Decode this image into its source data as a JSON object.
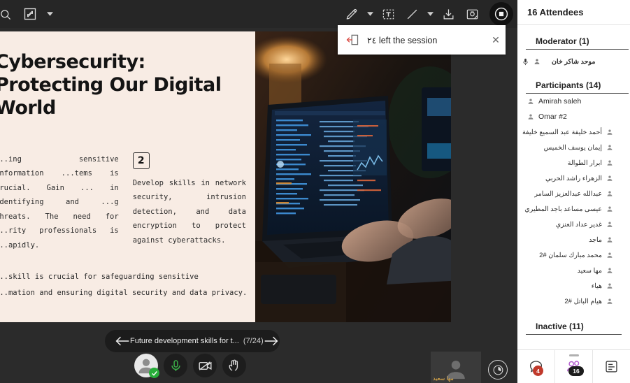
{
  "toolbar": {
    "search_icon": "search-icon",
    "fit_icon": "fit-screen-icon",
    "pen_icon": "pencil-icon",
    "text_icon": "text-box-icon",
    "line_icon": "line-icon",
    "download_icon": "download-icon",
    "snapshot_icon": "snapshot-icon",
    "record_icon": "stop-record-icon"
  },
  "toast": {
    "icon": "leave-session-icon",
    "message": "٢٤ left the session",
    "close_label": "✕"
  },
  "slide": {
    "title": "Cybersecurity: Protecting Our Digital World",
    "col1_text": "...ing sensitive information ...tems is crucial. Gain ... in identifying and ...g threats. The need for ...rity professionals is ...apidly.",
    "col2_number": "2",
    "col2_text": "Develop skills in network security, intrusion detection, and data encryption to protect against cyberattacks.",
    "footer_line1": "...skill is crucial for safeguarding sensitive",
    "footer_line2": "...mation and ensuring digital security and data privacy."
  },
  "slidenav": {
    "prev_icon": "arrow-left-icon",
    "next_icon": "arrow-right-icon",
    "label": "Future development skills for t...",
    "count": "(7/24)"
  },
  "controls": {
    "avatar_icon": "user-avatar-icon",
    "mic_icon": "microphone-icon",
    "camera_icon": "camera-off-icon",
    "hand_icon": "raise-hand-icon",
    "status_icon": "check-mark-icon",
    "clock_icon": "clock-icon",
    "mic_color": "#3cb54a",
    "ok_color": "#27ae39"
  },
  "video_thumb": {
    "name": "مها سعيد",
    "avatar_icon": "user-avatar-icon"
  },
  "sidebar": {
    "header": "16 Attendees",
    "moderator_section": {
      "title": "Moderator (1)",
      "items": [
        {
          "name": "موحد شاكر خان",
          "rtl": true,
          "mic": true
        }
      ]
    },
    "participants_section": {
      "title": "Participants (14)",
      "items": [
        {
          "name": "Amirah saleh",
          "rtl": false
        },
        {
          "name": "Omar #2",
          "rtl": false
        },
        {
          "name": "أحمد خليفة عبد السميع خليفة",
          "rtl": true
        },
        {
          "name": "إيمان يوسف الخميس",
          "rtl": true
        },
        {
          "name": "ابرار الطوالة",
          "rtl": true
        },
        {
          "name": "الزهراء راشد الحربي",
          "rtl": true
        },
        {
          "name": "عبدالله عبدالعزيز السامر",
          "rtl": true
        },
        {
          "name": "عيسى مساعد باجد المطيري",
          "rtl": true
        },
        {
          "name": "غدير عداد العنزي",
          "rtl": true
        },
        {
          "name": "ماجد",
          "rtl": true
        },
        {
          "name": "محمد مبارك سلمان #2",
          "rtl": true
        },
        {
          "name": "مها سعيد",
          "rtl": true
        },
        {
          "name": "هياء",
          "rtl": true
        },
        {
          "name": "هيام الباتل #2",
          "rtl": true
        }
      ]
    },
    "inactive_section": {
      "title": "Inactive (11)"
    },
    "footer": {
      "chat_icon": "chat-bubble-icon",
      "chat_badge": "4",
      "people_icon": "people-icon",
      "people_badge": "16",
      "notes_icon": "notes-icon",
      "people_color": "#b45ecf",
      "chat_badge_color": "#c0392b"
    }
  }
}
